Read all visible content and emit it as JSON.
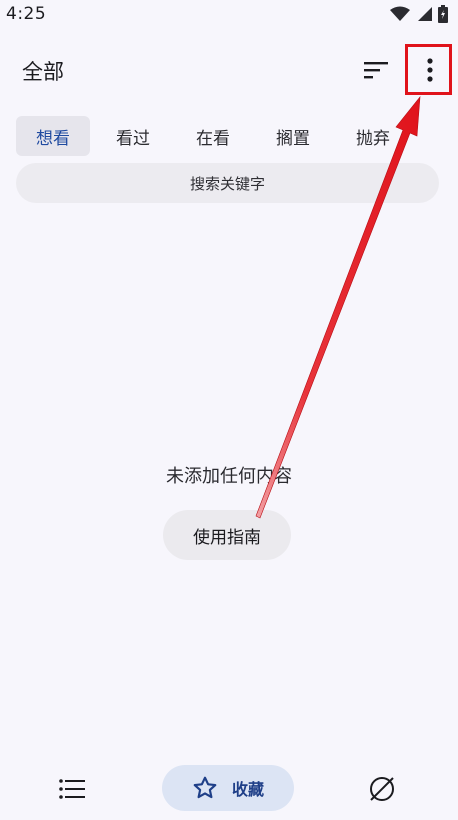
{
  "status": {
    "time": "4:25"
  },
  "header": {
    "title": "全部"
  },
  "tabs": [
    {
      "label": "想看",
      "active": true
    },
    {
      "label": "看过",
      "active": false
    },
    {
      "label": "在看",
      "active": false
    },
    {
      "label": "搁置",
      "active": false
    },
    {
      "label": "抛弃",
      "active": false
    }
  ],
  "search": {
    "placeholder": "搜索关键字"
  },
  "empty": {
    "message": "未添加任何内容",
    "guide_label": "使用指南"
  },
  "bottom_nav": {
    "favorites_label": "收藏"
  },
  "colors": {
    "accent": "#1f4aa0",
    "highlight": "#e0131b",
    "background": "#f7f6fc"
  },
  "icons": [
    "wifi-icon",
    "signal-icon",
    "battery-icon",
    "sort-icon",
    "more-vert-icon",
    "list-icon",
    "star-icon",
    "explore-icon"
  ]
}
